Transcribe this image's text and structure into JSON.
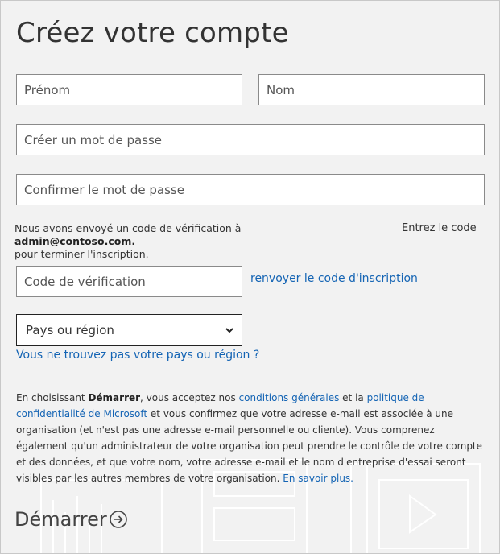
{
  "title": "Créez votre compte",
  "form": {
    "first_name_placeholder": "Prénom",
    "last_name_placeholder": "Nom",
    "password_placeholder": "Créer un mot de passe",
    "confirm_password_placeholder": "Confirmer le mot de passe",
    "verification_placeholder": "Code de vérification"
  },
  "verification": {
    "note_prefix": "Nous avons envoyé un code de vérification à ",
    "email": "admin@contoso.com.",
    "note_suffix": "pour terminer l'inscription.",
    "enter_code_label": "Entrez le code",
    "resend_link": "renvoyer le code d'inscription"
  },
  "country": {
    "selected": "Pays ou région",
    "not_found_link": "Vous ne trouvez pas votre pays ou région ?"
  },
  "terms": {
    "part1": "En choisissant ",
    "bold_start": "Démarrer",
    "part2": ", vous acceptez nos ",
    "link_conditions": "conditions générales",
    "part3": " et la ",
    "link_privacy": "politique de confidentialité de Microsoft",
    "part4": " et vous confirmez que votre adresse e-mail est associée à une organisation (et n'est pas une adresse e-mail personnelle ou cliente). Vous comprenez également qu'un administrateur de votre organisation peut prendre le contrôle de votre compte et des données, et que votre nom, votre adresse e-mail et le nom d'entreprise d'essai seront visibles par les autres membres de votre organisation. ",
    "link_learn_more": "En savoir plus."
  },
  "start_button": {
    "label": "Démarrer",
    "icon": "arrow-circle-right-icon"
  },
  "colors": {
    "link": "#1464b4",
    "background": "#f2f2f2"
  }
}
